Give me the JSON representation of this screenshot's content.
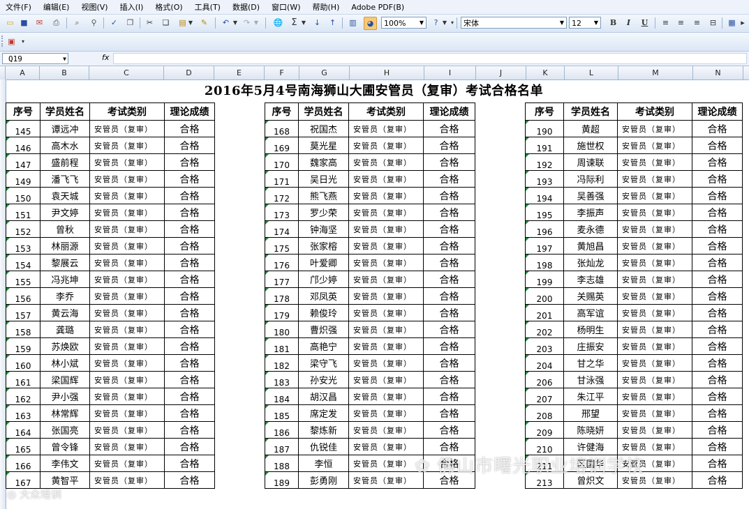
{
  "menu": [
    "文件(F)",
    "编辑(E)",
    "视图(V)",
    "插入(I)",
    "格式(O)",
    "工具(T)",
    "数据(D)",
    "窗口(W)",
    "帮助(H)",
    "Adobe PDF(B)"
  ],
  "toolbar": {
    "zoom": "100%",
    "font": "宋体",
    "font_size": "12",
    "bold": "B",
    "italic": "I",
    "underline": "U",
    "sum": "Σ"
  },
  "formula_bar": {
    "name_box": "Q19",
    "fx": "fx",
    "formula": ""
  },
  "columns": [
    "A",
    "B",
    "C",
    "D",
    "E",
    "F",
    "G",
    "H",
    "I",
    "J",
    "K",
    "L",
    "M",
    "N"
  ],
  "sheet": {
    "title": "2016年5月4号南海狮山大圃安管员（复审）考试合格名单",
    "headers": {
      "seq": "序号",
      "name": "学员姓名",
      "category": "考试类别",
      "score": "理论成绩"
    },
    "category_value": "安管员（复审）",
    "score_value": "合格",
    "left": [
      {
        "seq": "145",
        "name": "谭远冲"
      },
      {
        "seq": "146",
        "name": "高木水"
      },
      {
        "seq": "147",
        "name": "盛前程"
      },
      {
        "seq": "149",
        "name": "潘飞飞"
      },
      {
        "seq": "150",
        "name": "袁天城"
      },
      {
        "seq": "151",
        "name": "尹文婷"
      },
      {
        "seq": "152",
        "name": "曾秋"
      },
      {
        "seq": "153",
        "name": "林丽源"
      },
      {
        "seq": "154",
        "name": "黎展云"
      },
      {
        "seq": "155",
        "name": "冯兆坤"
      },
      {
        "seq": "156",
        "name": "李乔"
      },
      {
        "seq": "157",
        "name": "黄云海"
      },
      {
        "seq": "158",
        "name": "龚璐"
      },
      {
        "seq": "159",
        "name": "苏焕欧"
      },
      {
        "seq": "160",
        "name": "林小斌"
      },
      {
        "seq": "161",
        "name": "梁国辉"
      },
      {
        "seq": "162",
        "name": "尹小强"
      },
      {
        "seq": "163",
        "name": "林常辉"
      },
      {
        "seq": "164",
        "name": "张国亮"
      },
      {
        "seq": "165",
        "name": "曾令锋"
      },
      {
        "seq": "166",
        "name": "李伟文"
      },
      {
        "seq": "167",
        "name": "黄智平"
      }
    ],
    "middle": [
      {
        "seq": "168",
        "name": "祝国杰"
      },
      {
        "seq": "169",
        "name": "莫光星"
      },
      {
        "seq": "170",
        "name": "魏家高"
      },
      {
        "seq": "171",
        "name": "吴日光"
      },
      {
        "seq": "172",
        "name": "熊飞燕"
      },
      {
        "seq": "173",
        "name": "罗少荣"
      },
      {
        "seq": "174",
        "name": "钟海坚"
      },
      {
        "seq": "175",
        "name": "张家榕"
      },
      {
        "seq": "176",
        "name": "叶爱卿"
      },
      {
        "seq": "177",
        "name": "邝少婷"
      },
      {
        "seq": "178",
        "name": "邓凤英"
      },
      {
        "seq": "179",
        "name": "赖俊玲"
      },
      {
        "seq": "180",
        "name": "曹炽强"
      },
      {
        "seq": "181",
        "name": "高艳宁"
      },
      {
        "seq": "182",
        "name": "梁守飞"
      },
      {
        "seq": "183",
        "name": "孙安光"
      },
      {
        "seq": "184",
        "name": "胡汉昌"
      },
      {
        "seq": "185",
        "name": "席定发"
      },
      {
        "seq": "186",
        "name": "黎炼新"
      },
      {
        "seq": "187",
        "name": "仇锐佳"
      },
      {
        "seq": "188",
        "name": "李恒"
      },
      {
        "seq": "189",
        "name": "彭勇刚"
      }
    ],
    "right": [
      {
        "seq": "190",
        "name": "黄超"
      },
      {
        "seq": "191",
        "name": "施世权"
      },
      {
        "seq": "192",
        "name": "周谏联"
      },
      {
        "seq": "193",
        "name": "冯际利"
      },
      {
        "seq": "194",
        "name": "吴善强"
      },
      {
        "seq": "195",
        "name": "李振声"
      },
      {
        "seq": "196",
        "name": "麦永德"
      },
      {
        "seq": "197",
        "name": "黄旭昌"
      },
      {
        "seq": "198",
        "name": "张灿龙"
      },
      {
        "seq": "199",
        "name": "李志雄"
      },
      {
        "seq": "200",
        "name": "关赐英"
      },
      {
        "seq": "201",
        "name": "高军谊"
      },
      {
        "seq": "202",
        "name": "杨明生"
      },
      {
        "seq": "203",
        "name": "庄振安"
      },
      {
        "seq": "204",
        "name": "甘之华"
      },
      {
        "seq": "206",
        "name": "甘泳强"
      },
      {
        "seq": "207",
        "name": "朱江平"
      },
      {
        "seq": "208",
        "name": "邢望"
      },
      {
        "seq": "209",
        "name": "陈晓妍"
      },
      {
        "seq": "210",
        "name": "许健海"
      },
      {
        "seq": "211",
        "name": "区国华"
      },
      {
        "seq": "213",
        "name": "曾炽文"
      }
    ]
  },
  "watermarks": {
    "main": "佛山市曙光职业培训学校",
    "corner": "大众培训"
  }
}
